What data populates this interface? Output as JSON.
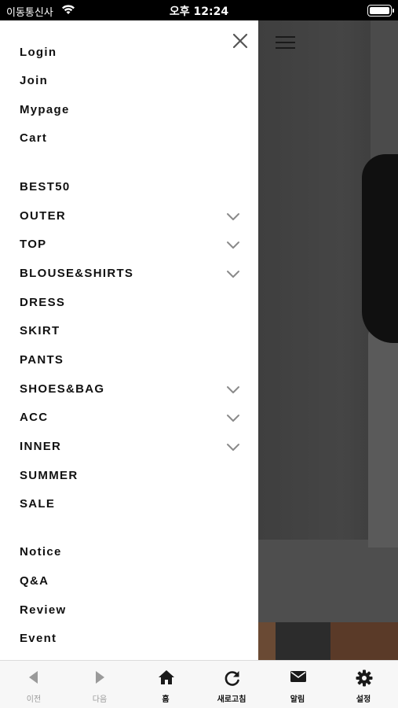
{
  "status_bar": {
    "carrier": "이동통신사",
    "time": "오후 12:24"
  },
  "drawer": {
    "account_items": [
      {
        "label": "Login"
      },
      {
        "label": "Join"
      },
      {
        "label": "Mypage"
      },
      {
        "label": "Cart"
      }
    ],
    "category_items": [
      {
        "label": "BEST50",
        "expandable": false
      },
      {
        "label": "OUTER",
        "expandable": true
      },
      {
        "label": "TOP",
        "expandable": true
      },
      {
        "label": "BLOUSE&SHIRTS",
        "expandable": true
      },
      {
        "label": "DRESS",
        "expandable": false
      },
      {
        "label": "SKIRT",
        "expandable": false
      },
      {
        "label": "PANTS",
        "expandable": false
      },
      {
        "label": "SHOES&BAG",
        "expandable": true
      },
      {
        "label": "ACC",
        "expandable": true
      },
      {
        "label": "INNER",
        "expandable": true
      },
      {
        "label": "SUMMER",
        "expandable": false
      },
      {
        "label": "SALE",
        "expandable": false
      }
    ],
    "board_items": [
      {
        "label": "Notice"
      },
      {
        "label": "Q&A"
      },
      {
        "label": "Review"
      },
      {
        "label": "Event"
      }
    ]
  },
  "toolbar": {
    "items": [
      {
        "label": "이전",
        "icon": "back-arrow-icon",
        "enabled": false
      },
      {
        "label": "다음",
        "icon": "forward-arrow-icon",
        "enabled": false
      },
      {
        "label": "홈",
        "icon": "home-icon",
        "enabled": true
      },
      {
        "label": "새로고침",
        "icon": "refresh-icon",
        "enabled": true
      },
      {
        "label": "알림",
        "icon": "envelope-icon",
        "enabled": true
      },
      {
        "label": "설정",
        "icon": "gear-icon",
        "enabled": true
      }
    ]
  },
  "colors": {
    "drawer_bg": "#ffffff",
    "text": "#111111",
    "chevron": "#8a8a8a",
    "overlay": "#404040",
    "toolbar_bg": "#f7f7f7",
    "disabled": "#9a9a9a"
  }
}
